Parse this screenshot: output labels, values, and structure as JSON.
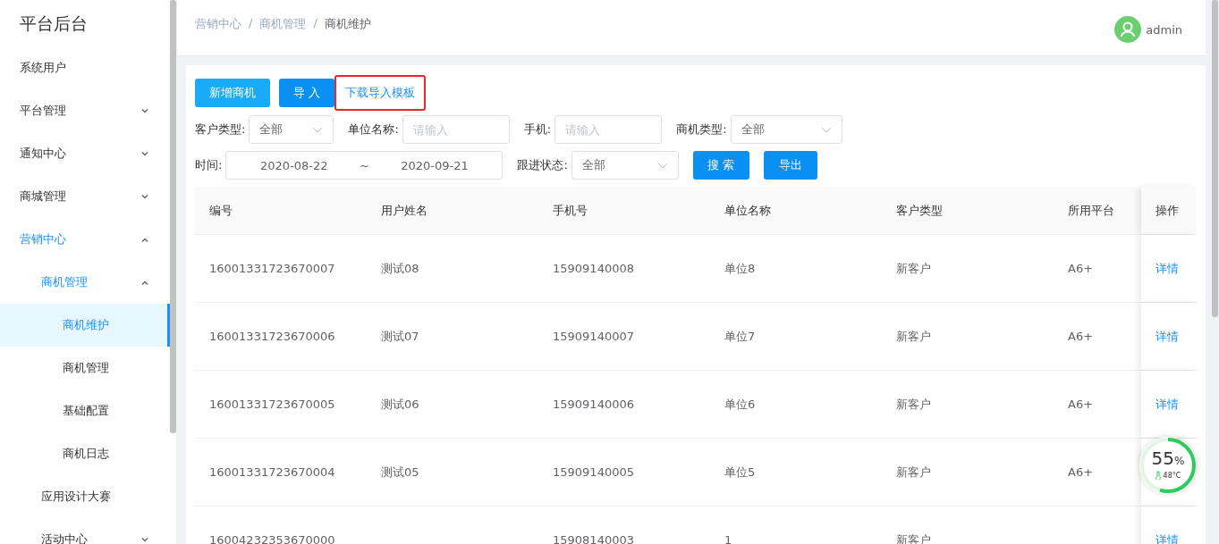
{
  "sidebar": {
    "title": "平台后台",
    "items": [
      {
        "label": "系统用户",
        "selected": false
      },
      {
        "label": "平台管理",
        "expanded": false,
        "selected": false
      },
      {
        "label": "通知中心",
        "expanded": false,
        "selected": false
      },
      {
        "label": "商城管理",
        "expanded": false,
        "selected": false
      },
      {
        "label": "营销中心",
        "expanded": true,
        "selected": false,
        "children": [
          {
            "label": "商机管理",
            "expanded": true,
            "selected": false,
            "children": [
              {
                "label": "商机维护",
                "selected": true
              },
              {
                "label": "商机管理",
                "selected": false
              },
              {
                "label": "基础配置",
                "selected": false
              },
              {
                "label": "商机日志",
                "selected": false
              }
            ]
          },
          {
            "label": "应用设计大赛",
            "selected": false
          },
          {
            "label": "活动中心",
            "expanded": false,
            "selected": false
          }
        ]
      }
    ]
  },
  "breadcrumb": {
    "separator": "/",
    "items": [
      "营销中心",
      "商机管理",
      "商机维护"
    ]
  },
  "user": {
    "name": "admin"
  },
  "toolbar": [
    {
      "label": "新增商机",
      "kind": "light",
      "highlighted": false
    },
    {
      "label": "导 入",
      "kind": "primary",
      "highlighted": false
    },
    {
      "label": "下载导入模板",
      "kind": "link",
      "highlighted": true
    }
  ],
  "filter_rows": [
    [
      {
        "kind": "select",
        "label": "客户类型:",
        "value": "全部"
      },
      {
        "kind": "input",
        "label": "单位名称:",
        "placeholder": "请输入"
      },
      {
        "kind": "input",
        "label": "手机:",
        "placeholder": "请输入"
      },
      {
        "kind": "select",
        "label": "商机类型:",
        "value": "全部"
      }
    ],
    [
      {
        "kind": "daterange",
        "label": "时间:",
        "start": "2020-08-22",
        "separator": "~",
        "end": "2020-09-21"
      },
      {
        "kind": "select",
        "label": "跟进状态:",
        "value": "全部"
      },
      {
        "kind": "button",
        "label": "搜 索"
      },
      {
        "kind": "button",
        "label": "导出"
      }
    ]
  ],
  "table": {
    "columns": [
      "编号",
      "用户姓名",
      "手机号",
      "单位名称",
      "客户类型",
      "所用平台",
      "操作"
    ],
    "rows": [
      {
        "cells": [
          "16001331723670007",
          "测试08",
          "15909140008",
          "单位8",
          "新客户",
          "A6+"
        ],
        "action": "详情"
      },
      {
        "cells": [
          "16001331723670006",
          "测试07",
          "15909140007",
          "单位7",
          "新客户",
          "A6+"
        ],
        "action": "详情"
      },
      {
        "cells": [
          "16001331723670005",
          "测试06",
          "15909140006",
          "单位6",
          "新客户",
          "A6+"
        ],
        "action": "详情"
      },
      {
        "cells": [
          "16001331723670004",
          "测试05",
          "15909140005",
          "单位5",
          "新客户",
          "A6+"
        ]
      },
      {
        "cells": [
          "16004232353670000",
          "",
          "15908140003",
          "1",
          "新客户",
          ""
        ],
        "action": "详情"
      }
    ]
  },
  "gauge": {
    "level": 0.55,
    "value": "55",
    "unit": "%",
    "temperature": "48°C"
  }
}
